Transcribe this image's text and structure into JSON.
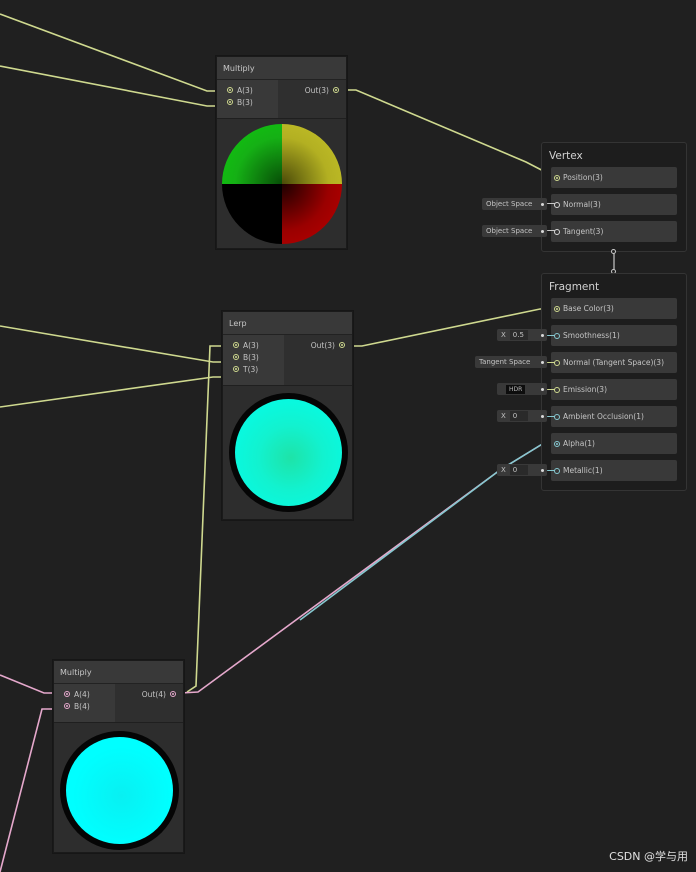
{
  "nodes": {
    "multiply_top": {
      "title": "Multiply",
      "inputs": [
        "A(3)",
        "B(3)"
      ],
      "output": "Out(3)"
    },
    "lerp": {
      "title": "Lerp",
      "inputs": [
        "A(3)",
        "B(3)",
        "T(3)"
      ],
      "output": "Out(3)"
    },
    "multiply_bottom": {
      "title": "Multiply",
      "inputs": [
        "A(4)",
        "B(4)"
      ],
      "output": "Out(4)"
    }
  },
  "vertex": {
    "title": "Vertex",
    "slots": [
      "Position(3)",
      "Normal(3)",
      "Tangent(3)"
    ],
    "normal_space": "Object Space",
    "tangent_space": "Object Space"
  },
  "fragment": {
    "title": "Fragment",
    "slots": [
      "Base Color(3)",
      "Smoothness(1)",
      "Normal (Tangent Space)(3)",
      "Emission(3)",
      "Ambient Occlusion(1)",
      "Alpha(1)",
      "Metallic(1)"
    ],
    "smoothness_label": "X",
    "smoothness_value": "0.5",
    "normal_space": "Tangent Space",
    "emission_label": "HDR",
    "ao_label": "X",
    "ao_value": "0",
    "metallic_label": "X",
    "metallic_value": "0"
  },
  "watermark": "CSDN @学与用",
  "colors": {
    "background": "#202020",
    "wire_vector3": "#cfd98f",
    "wire_vector4": "#e5a8cc",
    "wire_float": "#86c8d0",
    "preview_cyan": "#00ffee"
  }
}
